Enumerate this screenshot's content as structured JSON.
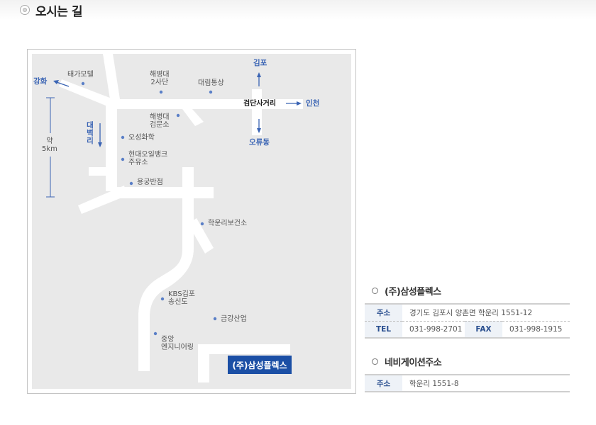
{
  "page": {
    "title": "오시는 길"
  },
  "map": {
    "labels": {
      "ganghwa": "강화",
      "tega_motel": "태가모텔",
      "marine_2": "해병대\n2사단",
      "daerim": "대림통상",
      "gimpo": "김포",
      "geomdan": "검단사거리",
      "incheon": "인천",
      "marine_geomun": "해병대\n검문소",
      "oryu": "오류동",
      "daebyeokri": "대\n벽\n리",
      "about_5km": "약\n5km",
      "oseong": "오성화학",
      "hyundai_oil": "현대오일뱅크\n주유소",
      "yonggung": "용궁반점",
      "hakun_health": "학운리보건소",
      "kbs": "KBS김포\n송신도",
      "geumgang": "금강산업",
      "jungang": "중앙\n엔지니어링",
      "company": "(주)삼성플렉스"
    }
  },
  "company_info": {
    "title": "(주)삼성플렉스",
    "address_label": "주소",
    "address": "경기도 김포시 양촌면 학운리 1551-12",
    "tel_label": "TEL",
    "tel": "031-998-2701",
    "fax_label": "FAX",
    "fax": "031-998-1915"
  },
  "navi_info": {
    "title": "네비게이션주소",
    "address_label": "주소",
    "address": "학운리 1551-8"
  },
  "colors": {
    "accent_blue": "#3a64b4",
    "company_box": "#1b4fa5",
    "road": "#ffffff",
    "map_bg": "#e9e9e9"
  }
}
